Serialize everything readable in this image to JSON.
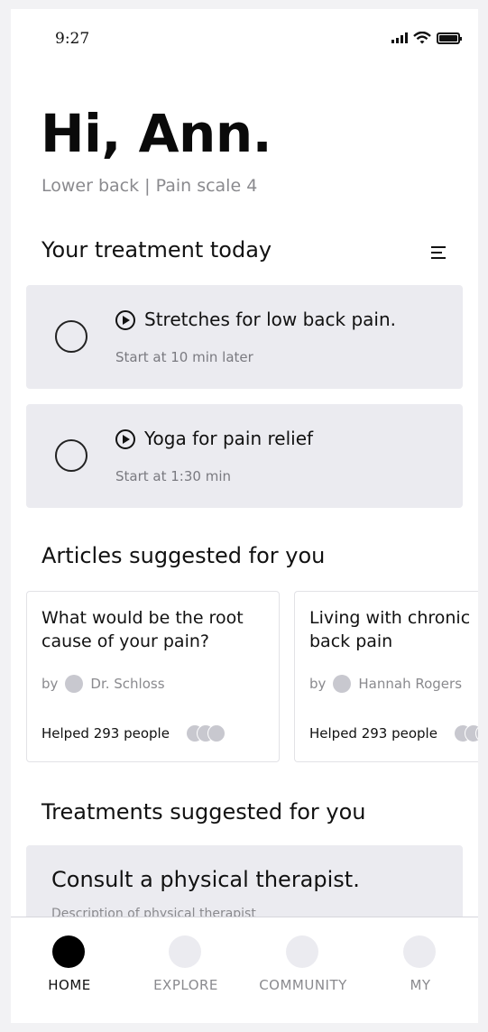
{
  "status_bar": {
    "time": "9:27"
  },
  "header": {
    "greeting": "Hi, Ann.",
    "subtitle": "Lower back | Pain scale 4"
  },
  "treatment_today": {
    "title": "Your treatment today",
    "items": [
      {
        "title": "Stretches for low back pain.",
        "subtitle": "Start at 10 min later"
      },
      {
        "title": "Yoga for pain relief",
        "subtitle": "Start at 1:30 min"
      }
    ]
  },
  "articles": {
    "title": "Articles suggested for you",
    "items": [
      {
        "title": "What would be the root\ncause of your pain?",
        "by_label": "by",
        "author": "Dr. Schloss",
        "helped": "Helped 293 people"
      },
      {
        "title": "Living with chronic\nback pain",
        "by_label": "by",
        "author": "Hannah Rogers",
        "helped": "Helped 293 people"
      }
    ]
  },
  "treatments": {
    "title": "Treatments suggested for you",
    "items": [
      {
        "title": "Consult a physical therapist.",
        "description": "Description of physical therapist"
      }
    ]
  },
  "tabbar": {
    "active": "HOME",
    "tabs": [
      {
        "label": "HOME"
      },
      {
        "label": "EXPLORE"
      },
      {
        "label": "COMMUNITY"
      },
      {
        "label": "MY"
      }
    ]
  },
  "colors": {
    "card_bg": "#ebebf0",
    "muted_text": "#8a8a8e",
    "active_tab": "#000000"
  }
}
